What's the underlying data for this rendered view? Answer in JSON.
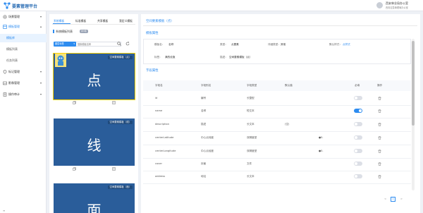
{
  "app": {
    "title": "要素管理平台"
  },
  "user": {
    "name": "西安林业局办公室",
    "dept": "西安应急管理局办公室"
  },
  "sidebar": {
    "items": [
      {
        "label": "场景管理",
        "expanded": false
      },
      {
        "label": "模板管理",
        "expanded": true,
        "active": true,
        "children": [
          {
            "label": "模板库",
            "selected": true
          },
          {
            "label": "模板列表",
            "selected": false
          },
          {
            "label": "任务列表",
            "selected": false
          }
        ]
      },
      {
        "label": "标记管理",
        "expanded": false
      },
      {
        "label": "影像管理",
        "expanded": false
      },
      {
        "label": "操作审计",
        "expanded": false
      }
    ],
    "bottom_label": "≡"
  },
  "left_panel": {
    "tabs": [
      {
        "label": "系统模板",
        "active": true
      },
      {
        "label": "标准模板",
        "active": false
      },
      {
        "label": "共享模板",
        "active": false
      },
      {
        "label": "我定义模板",
        "active": false
      }
    ],
    "list_title": "系统模板列表",
    "list_count": "共3条",
    "filter": {
      "selected": "图层标签"
    },
    "search": {
      "placeholder": "搜索模板名称"
    },
    "cards": [
      {
        "badge": "空间要素模板（点）",
        "char": "点"
      },
      {
        "badge": "空间要素模板（线）",
        "char": "线"
      },
      {
        "badge": "空间要素模板（面）",
        "char": "面"
      }
    ]
  },
  "right_panel": {
    "title": "空间要素模板（点）",
    "template_section_title": "模板属性",
    "info": {
      "name_label": "模板名：",
      "name_value": "名称",
      "type_label": "类型：",
      "type_value": "点要素",
      "detail_label": "详细类型：",
      "detail_value": "其他",
      "default_style_label": "默认样式：",
      "default_style_value": "点样式",
      "tag_label": "标签：",
      "tag_value": "满的设施",
      "desc_label": "描述：",
      "desc_value": "空间要素模板（点）"
    },
    "field_section_title": "字段属性",
    "table": {
      "headers": [
        "字段名",
        "字段别名",
        "字段类型",
        "默认值",
        "必填",
        "操作"
      ],
      "rows": [
        {
          "name": "id",
          "alias": "编号",
          "type": "长整型",
          "default": "",
          "extra": "",
          "required": false
        },
        {
          "name": "name",
          "alias": "名称",
          "type": "短文本",
          "default": "",
          "extra": "",
          "required": true
        },
        {
          "name": "description",
          "alias": "描述",
          "type": "长文本",
          "default": "(空)",
          "extra": "",
          "required": false
        },
        {
          "name": "centerLatitude",
          "alias": "中心点纬度",
          "type": "双精度型",
          "default": "",
          "extra": "●5.",
          "required": false
        },
        {
          "name": "centerLongitude",
          "alias": "中心点经度",
          "type": "双精度型",
          "default": "",
          "extra": "●5.",
          "required": false
        },
        {
          "name": "cover",
          "alias": "封面",
          "type": "文件",
          "default": "",
          "extra": "",
          "required": false
        },
        {
          "name": "address",
          "alias": "地址",
          "type": "长文本",
          "default": "",
          "extra": "",
          "required": false
        }
      ]
    },
    "pagination": {
      "prev": "<",
      "current": "1",
      "next": ">"
    }
  },
  "colors": {
    "accent": "#2d8cf0",
    "card": "#2a5d9a",
    "selected_border": "#ffd200"
  }
}
